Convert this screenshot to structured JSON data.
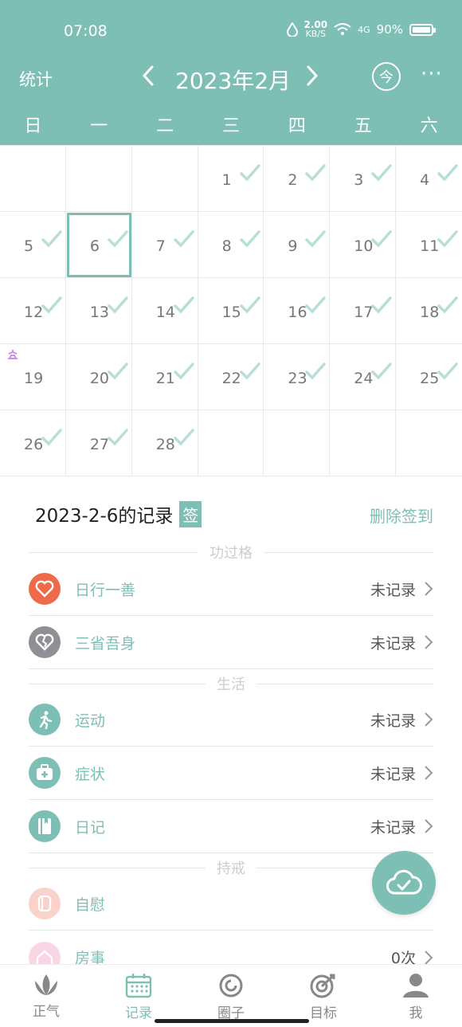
{
  "status_bar": {
    "time": "07:08",
    "net_speed_value": "2.00",
    "net_speed_unit": "KB/S",
    "network": "4G",
    "battery": "90%"
  },
  "header": {
    "stats_label": "统计",
    "month_title": "2023年2月",
    "today_label": "今",
    "more_label": "···"
  },
  "weekdays": [
    "日",
    "一",
    "二",
    "三",
    "四",
    "五",
    "六"
  ],
  "calendar": {
    "selected_day": 6,
    "flag_day": 19,
    "unchecked_day": 19,
    "days": [
      "",
      "",
      "",
      "1",
      "2",
      "3",
      "4",
      "5",
      "6",
      "7",
      "8",
      "9",
      "10",
      "11",
      "12",
      "13",
      "14",
      "15",
      "16",
      "17",
      "18",
      "19",
      "20",
      "21",
      "22",
      "23",
      "24",
      "25",
      "26",
      "27",
      "28",
      "",
      "",
      "",
      ""
    ]
  },
  "records": {
    "title": "2023-2-6的记录",
    "sign_badge": "签",
    "delete_label": "删除签到",
    "sections": [
      {
        "name": "功过格"
      },
      {
        "name": "生活"
      },
      {
        "name": "持戒"
      }
    ],
    "items": [
      {
        "label": "日行一善",
        "value": "未记录",
        "icon": "heart-icon",
        "color": "#ee6a4b"
      },
      {
        "label": "三省吾身",
        "value": "未记录",
        "icon": "broken-heart-icon",
        "color": "#8f8f95"
      },
      {
        "label": "运动",
        "value": "未记录",
        "icon": "running-icon",
        "color": "#7dbfb4"
      },
      {
        "label": "症状",
        "value": "未记录",
        "icon": "medical-kit-icon",
        "color": "#7dbfb4"
      },
      {
        "label": "日记",
        "value": "未记录",
        "icon": "diary-icon",
        "color": "#7dbfb4"
      },
      {
        "label": "自慰",
        "value": "",
        "icon": "tissue-icon",
        "color": "#f7c7bd"
      },
      {
        "label": "房事",
        "value": "0次",
        "icon": "house-icon",
        "color": "#f5c8dc"
      }
    ]
  },
  "fab": {
    "icon": "cloud-sync-icon"
  },
  "bottom_nav": [
    {
      "label": "正气",
      "icon": "lotus-icon"
    },
    {
      "label": "记录",
      "icon": "calendar-icon",
      "active": true
    },
    {
      "label": "圈子",
      "icon": "circle-icon"
    },
    {
      "label": "目标",
      "icon": "target-icon"
    },
    {
      "label": "我",
      "icon": "person-icon"
    }
  ],
  "colors": {
    "accent": "#7dbfb4",
    "check": "#b7ded8",
    "flag": "#c58be0"
  }
}
